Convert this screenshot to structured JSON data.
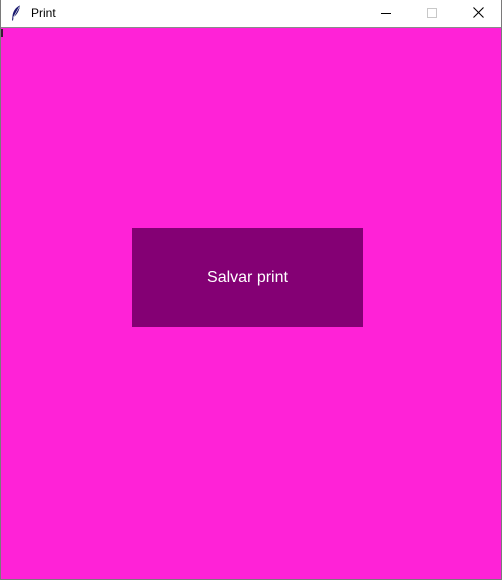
{
  "window": {
    "title": "Print",
    "icons": {
      "app": "feather-icon",
      "minimize": "minimize-icon",
      "maximize": "maximize-icon",
      "close": "close-icon"
    }
  },
  "main": {
    "background_color": "#ff22d7",
    "save_button": {
      "label": "Salvar print",
      "background_color": "#840074",
      "text_color": "#ffffff"
    }
  }
}
